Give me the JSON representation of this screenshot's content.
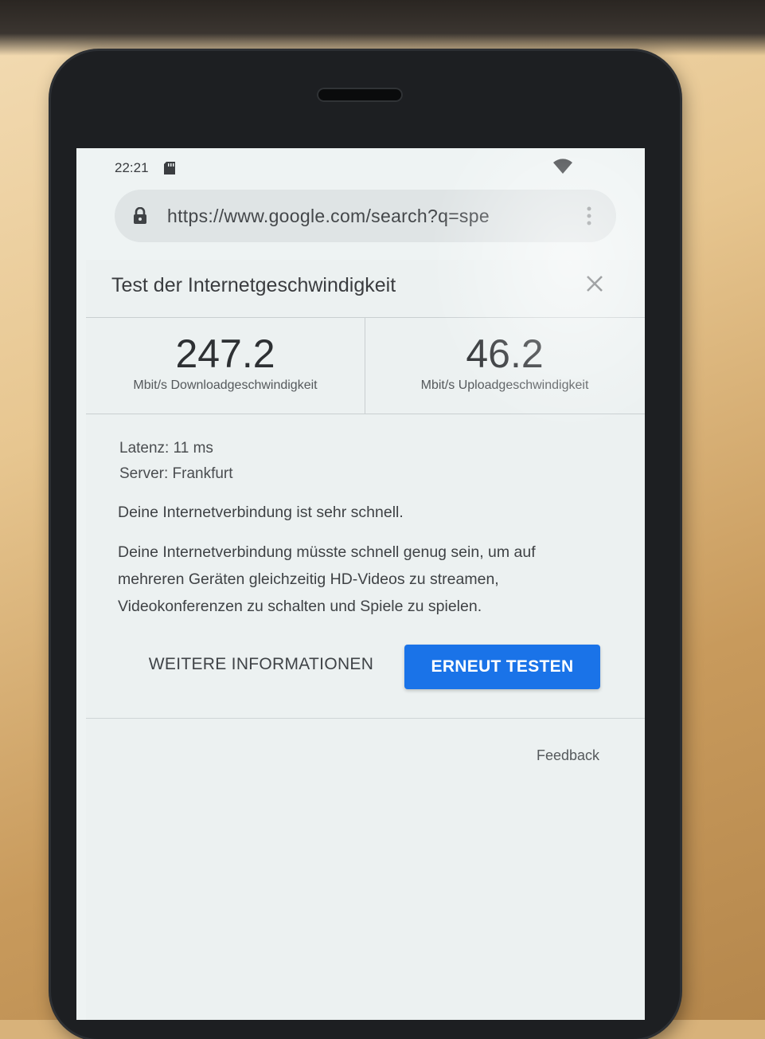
{
  "status_bar": {
    "time": "22:21"
  },
  "browser": {
    "url": "https://www.google.com/search?q=spe"
  },
  "speedtest": {
    "title": "Test der Internetgeschwindigkeit",
    "download": {
      "value": "247.2",
      "label": "Mbit/s Downloadgeschwindigkeit"
    },
    "upload": {
      "value": "46.2",
      "label": "Mbit/s Uploadgeschwindigkeit"
    },
    "latency": "Latenz: 11 ms",
    "server": "Server: Frankfurt",
    "summary": "Deine Internetverbindung ist sehr schnell.",
    "description_lines": [
      "Deine Internetverbindung müsste schnell genug sein, um auf",
      "mehreren Geräten gleichzeitig HD-Videos zu streamen,",
      "Videokonferenzen zu schalten und Spiele zu spielen."
    ],
    "more_info_label": "WEITERE INFORMATIONEN",
    "retest_label": "ERNEUT TESTEN",
    "feedback_label": "Feedback"
  },
  "icons": {
    "lock": "lock-icon",
    "close": "close-icon",
    "wifi": "wifi-icon",
    "sd_card": "sd-card-icon",
    "menu": "more-vert-icon"
  },
  "colors": {
    "accent": "#1a73e8"
  }
}
